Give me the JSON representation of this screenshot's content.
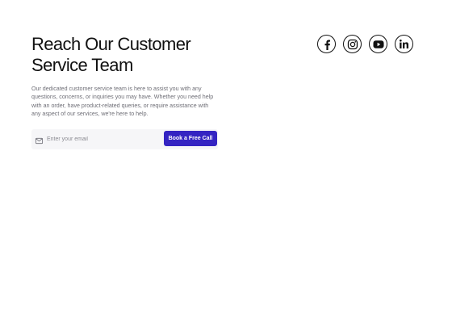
{
  "hero": {
    "title_line1": "Reach Our Customer",
    "title_line2": "Service Team",
    "description": "Our dedicated customer service team is here to assist you with any questions, concerns, or inquiries you may have. Whether you need help with an order, have product-related queries, or require assistance with any aspect of our services, we're here to help."
  },
  "email_form": {
    "placeholder": "Enter your email",
    "button_label": "Book a Free Call",
    "icon": "mail-icon"
  },
  "socials": [
    {
      "icon": "facebook-icon"
    },
    {
      "icon": "instagram-icon"
    },
    {
      "icon": "youtube-icon"
    },
    {
      "icon": "linkedin-icon"
    }
  ],
  "colors": {
    "accent": "#3424c2",
    "text": "#111111",
    "muted": "#6e6e76",
    "field_bg": "#f6f6f8"
  }
}
